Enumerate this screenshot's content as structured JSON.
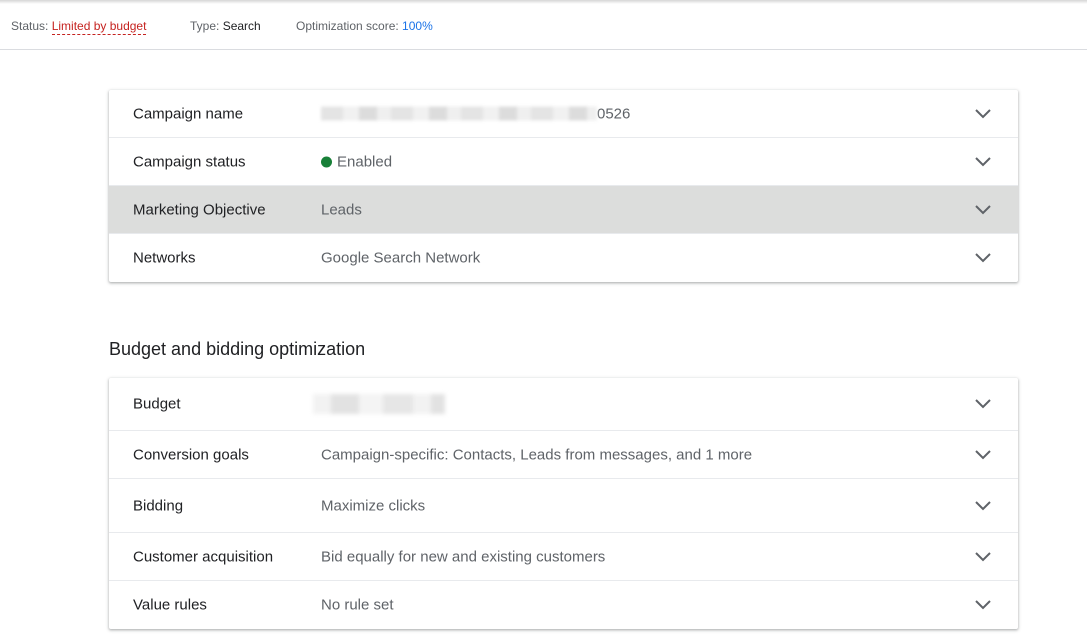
{
  "status_bar": {
    "status_key": "Status:",
    "status_value": "Limited by budget",
    "type_key": "Type:",
    "type_value": "Search",
    "score_key": "Optimization score:",
    "score_value": "100%"
  },
  "campaign_settings": {
    "name": {
      "label": "Campaign name",
      "value_suffix": "0526"
    },
    "status": {
      "label": "Campaign status",
      "value": "Enabled"
    },
    "objective": {
      "label": "Marketing Objective",
      "value": "Leads"
    },
    "networks": {
      "label": "Networks",
      "value": "Google Search Network"
    }
  },
  "budget_section": {
    "title": "Budget and bidding optimization",
    "budget": {
      "label": "Budget"
    },
    "conversion_goals": {
      "label": "Conversion goals",
      "value": "Campaign-specific: Contacts, Leads from messages, and 1 more"
    },
    "bidding": {
      "label": "Bidding",
      "value": "Maximize clicks"
    },
    "customer_acquisition": {
      "label": "Customer acquisition",
      "value": "Bid equally for new and existing customers"
    },
    "value_rules": {
      "label": "Value rules",
      "value": "No rule set"
    }
  },
  "colors": {
    "status_limited": "#c5221f",
    "score": "#1a73e8",
    "enabled_dot": "#188038",
    "highlight_row": "#dcdddc"
  },
  "icons": {
    "expand": "chevron-down-icon",
    "status": "status-dot-icon"
  }
}
